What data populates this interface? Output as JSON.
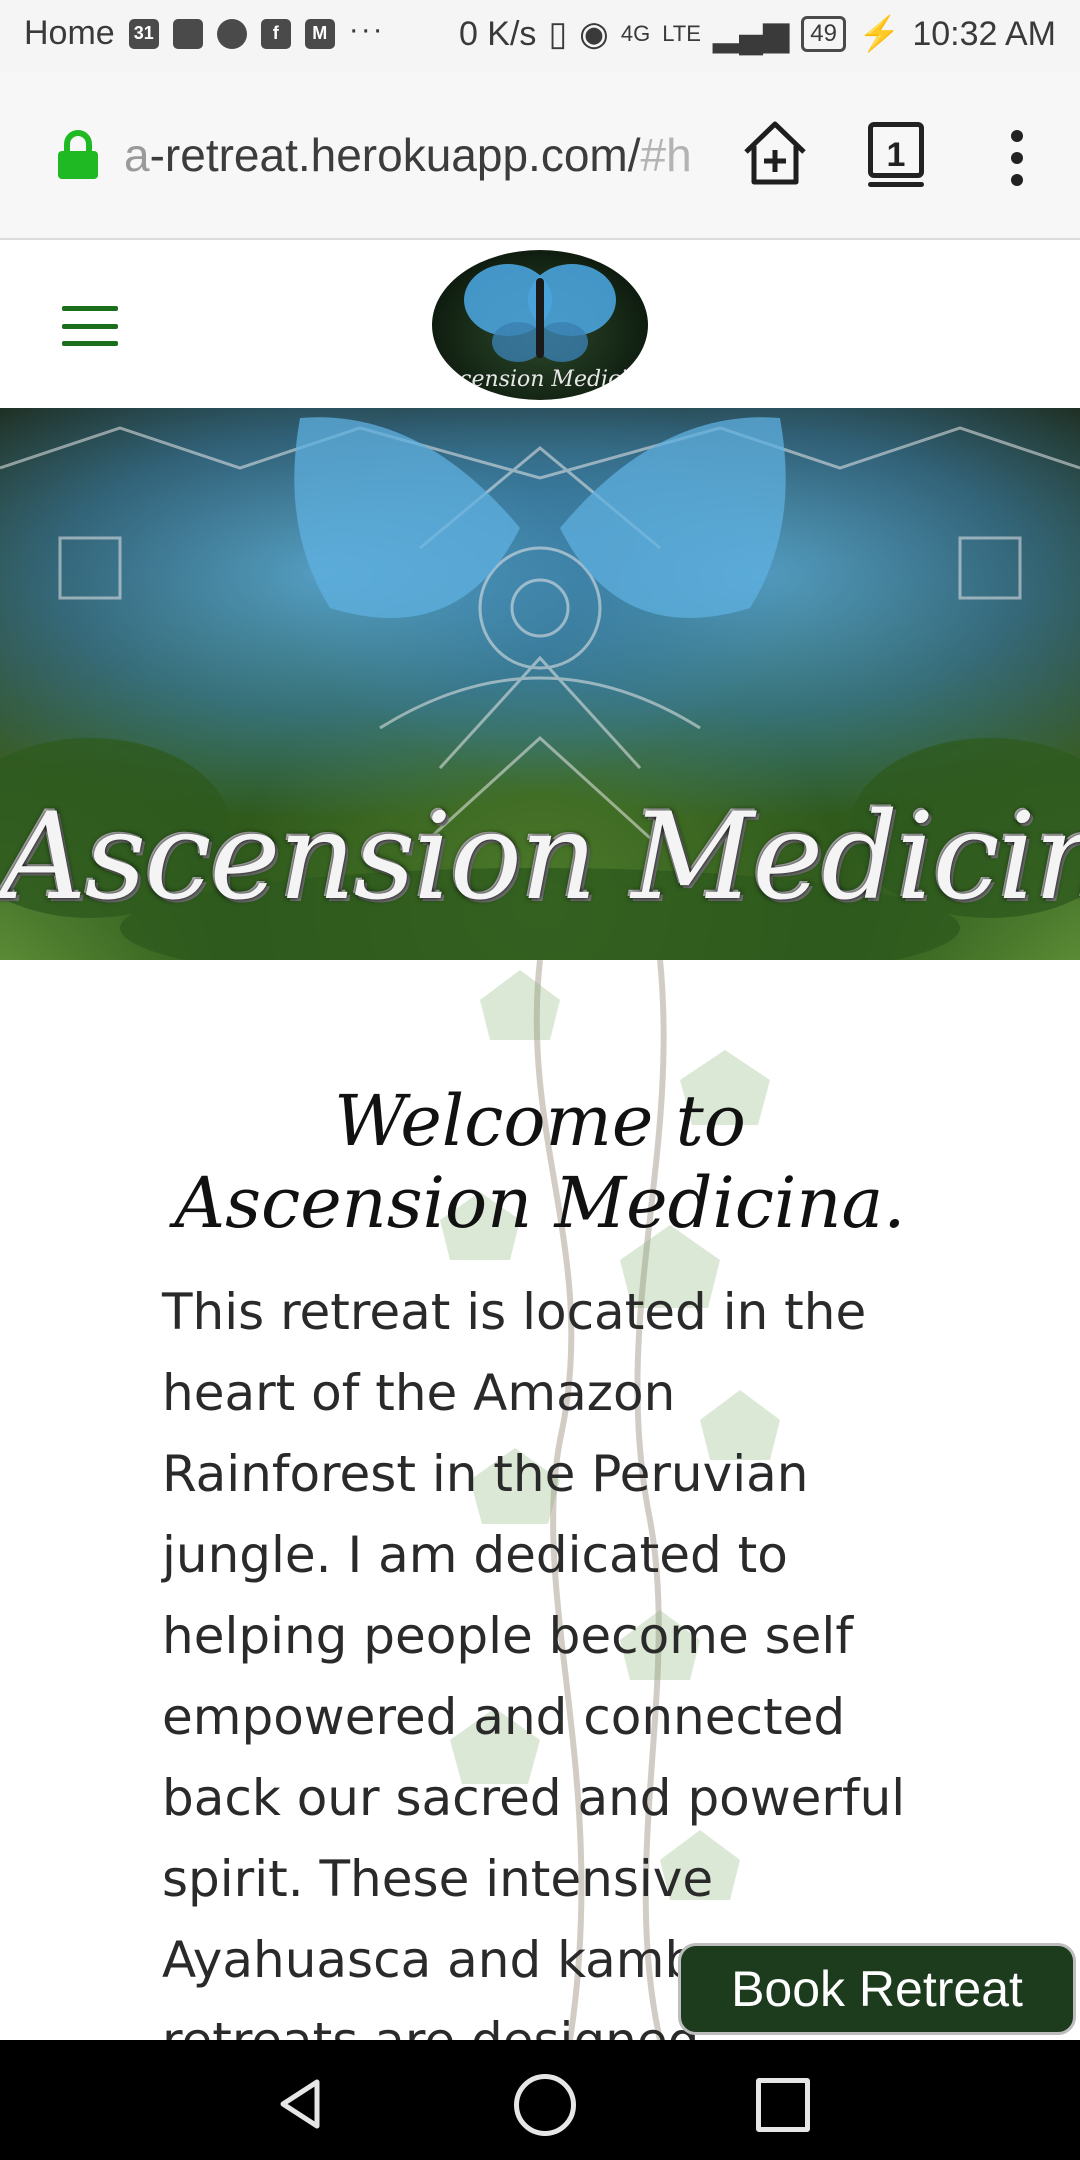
{
  "status_bar": {
    "carrier": "Home",
    "calendar_day": "31",
    "speed": "0 K/s",
    "network": "4G",
    "network_sub": "LTE",
    "battery": "49",
    "time": "10:32 AM",
    "icons": [
      "calendar-icon",
      "inbox-icon",
      "hangouts-icon",
      "facebook-icon",
      "gmail-icon",
      "more-icon",
      "vibrate-icon",
      "eye-icon",
      "signal-icon",
      "battery-icon",
      "charging-icon"
    ]
  },
  "browser": {
    "url_faded": "a",
    "url_main": "-retreat.herokuapp.com/",
    "url_tail": "#h",
    "tab_count": "1",
    "lock_color": "#1fb924"
  },
  "site": {
    "logo_text": "Ascension Medicina",
    "hero_title": "Ascension Medicina",
    "welcome_title": "Welcome to Ascension Medicina.",
    "intro_text": "This retreat is located in the heart of the Amazon Rainforest in the Peruvian jungle. I am dedicated to helping people become self empowered and connected back our sacred and powerful spirit. These intensive Ayahuasca and kambo retreats are designed",
    "book_button": "Book Retreat",
    "accent_color": "#1b6e1b",
    "button_color": "#1d3b1d"
  }
}
